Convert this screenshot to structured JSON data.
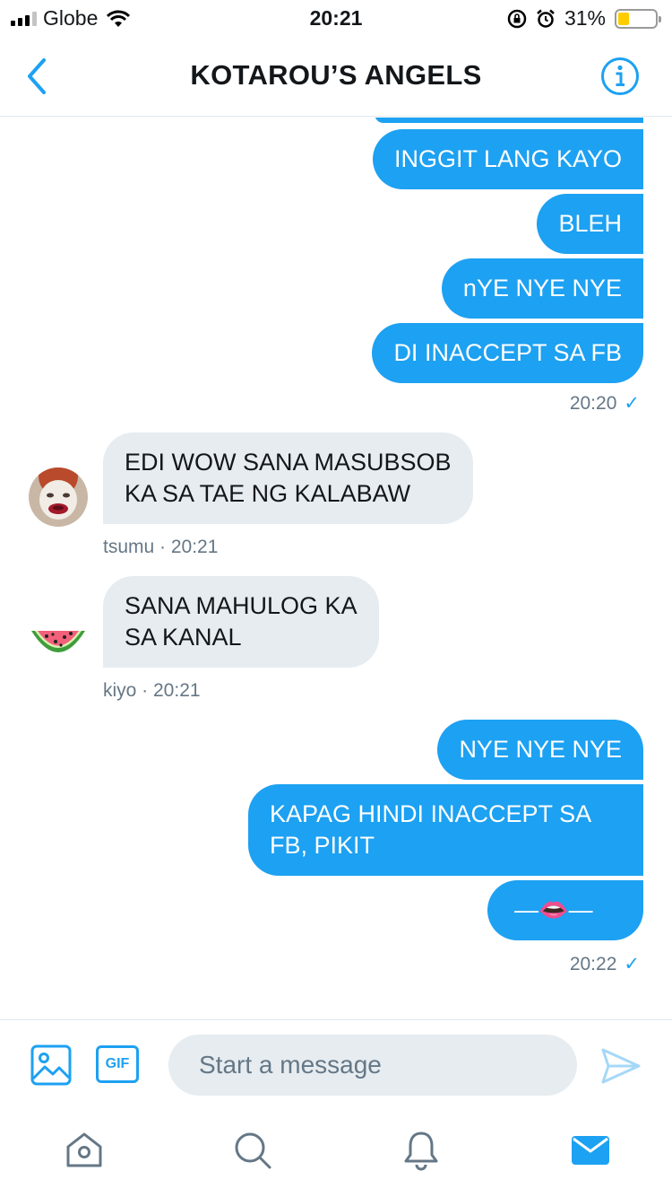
{
  "status_bar": {
    "carrier": "Globe",
    "time": "20:21",
    "battery_pct": "31%",
    "battery_level": 0.31,
    "icons": [
      "signal-icon",
      "wifi-icon",
      "rotation-lock-icon",
      "alarm-icon",
      "battery-icon"
    ]
  },
  "header": {
    "title": "KOTAROU’S ANGELS",
    "back_icon": "chevron-left-icon",
    "info_icon": "info-icon"
  },
  "messages": [
    {
      "dir": "out",
      "text": "INGGIT LANG KAYO"
    },
    {
      "dir": "out",
      "text": "BLEH"
    },
    {
      "dir": "out",
      "text": "nYE NYE NYE"
    },
    {
      "dir": "out",
      "text": "DI INACCEPT SA FB",
      "time": "20:20"
    },
    {
      "dir": "in",
      "text": "EDI WOW SANA MASUBSOB\nKA SA TAE NG KALABAW",
      "sender": "tsumu",
      "time": "20:21"
    },
    {
      "dir": "in",
      "text": "SANA MAHULOG KA\nSA KANAL",
      "sender": "kiyo",
      "time": "20:21"
    },
    {
      "dir": "out",
      "text": "NYE NYE NYE"
    },
    {
      "dir": "out",
      "text": "KAPAG HINDI INACCEPT SA\nFB, PIKIT"
    },
    {
      "dir": "out",
      "text": "—👄—",
      "time": "20:22"
    }
  ],
  "meta": {
    "t1": "20:20",
    "tsumu": "tsumu · 20:21",
    "kiyo": "kiyo · 20:21",
    "t2": "20:22",
    "check": "✓"
  },
  "composer": {
    "placeholder": "Start a message",
    "gif_label": "GIF"
  },
  "tabs": [
    "home-icon",
    "search-icon",
    "notifications-icon",
    "messages-icon"
  ],
  "colors": {
    "accent": "#1da1f2",
    "incoming_bubble": "#e6ecf0",
    "meta_text": "#657786",
    "battery": "#ffcc00"
  }
}
